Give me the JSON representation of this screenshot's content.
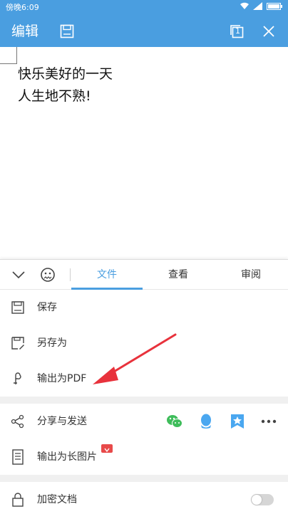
{
  "status_bar": {
    "time": "傍晚6:09"
  },
  "app_bar": {
    "title": "编辑",
    "page_badge": "1"
  },
  "document": {
    "lines": [
      "快乐美好的一天",
      "人生地不熟!"
    ]
  },
  "toolbar": {
    "tabs": [
      {
        "label": "文件",
        "active": true
      },
      {
        "label": "查看",
        "active": false
      },
      {
        "label": "审阅",
        "active": false
      }
    ]
  },
  "file_menu": {
    "save": "保存",
    "save_as": "另存为",
    "export_pdf": "输出为PDF",
    "share": "分享与发送",
    "export_long_image": "输出为长图片",
    "encrypt": "加密文档"
  },
  "colors": {
    "accent": "#4a9ee0",
    "wechat": "#3fbd5b",
    "qq": "#4aa7f0",
    "arrow": "#e8323c"
  },
  "icons": [
    "wifi-icon",
    "signal-icon",
    "battery-icon",
    "save-icon",
    "pages-icon",
    "close-icon",
    "chevron-down-icon",
    "emoji-icon",
    "save-file-icon",
    "save-as-icon",
    "pdf-icon",
    "share-icon",
    "wechat-icon",
    "qq-icon",
    "favorite-icon",
    "more-icon",
    "long-image-icon",
    "lock-icon"
  ]
}
